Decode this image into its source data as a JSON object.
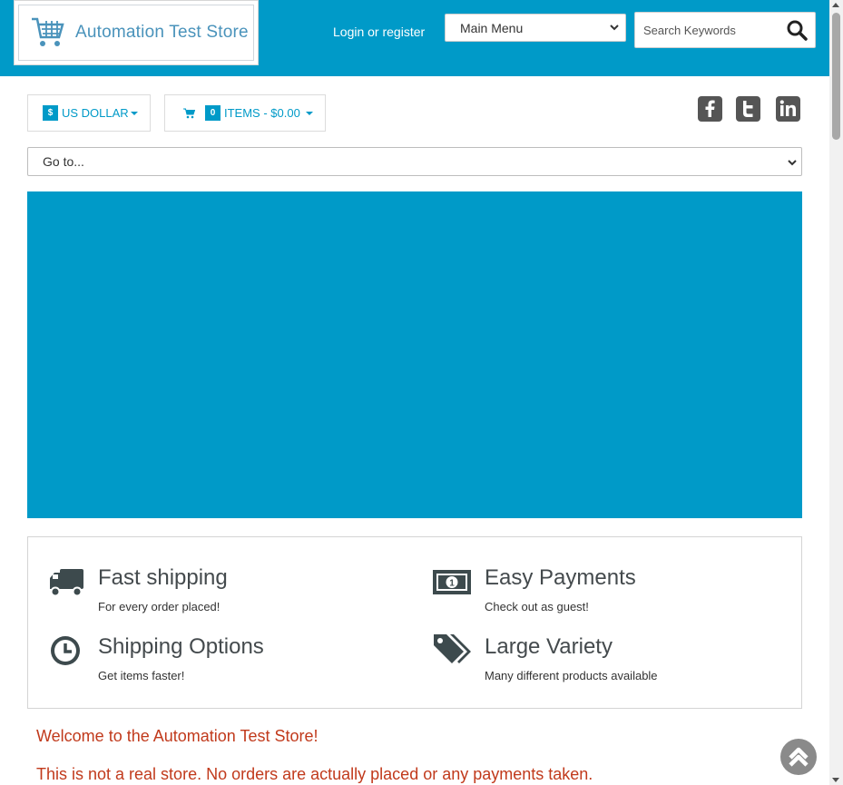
{
  "header": {
    "logo_text": "Automation Test Store",
    "login_link": "Login or register",
    "main_menu_selected": "Main Menu",
    "search_placeholder": "Search Keywords"
  },
  "toolbar": {
    "currency_symbol": "$",
    "currency_label": "US DOLLAR",
    "cart_count": "0",
    "cart_label": "ITEMS - $0.00",
    "social": [
      "facebook-icon",
      "twitter-icon",
      "linkedin-icon"
    ]
  },
  "goto_selected": "Go to...",
  "features": [
    {
      "icon": "truck-icon",
      "title": "Fast shipping",
      "subtitle": "For every order placed!"
    },
    {
      "icon": "banknote-icon",
      "title": "Easy Payments",
      "subtitle": "Check out as guest!"
    },
    {
      "icon": "clock-icon",
      "title": "Shipping Options",
      "subtitle": "Get items faster!"
    },
    {
      "icon": "tags-icon",
      "title": "Large Variety",
      "subtitle": "Many different products available"
    }
  ],
  "welcome": {
    "heading": "Welcome to the Automation Test Store!",
    "disclaimer": "This is not a real store. No orders are actually placed or any payments taken."
  },
  "colors": {
    "brand": "#009ac8",
    "text_dark": "#444a4d",
    "welcome_text": "#c13a1c",
    "social_bg": "#555555"
  }
}
